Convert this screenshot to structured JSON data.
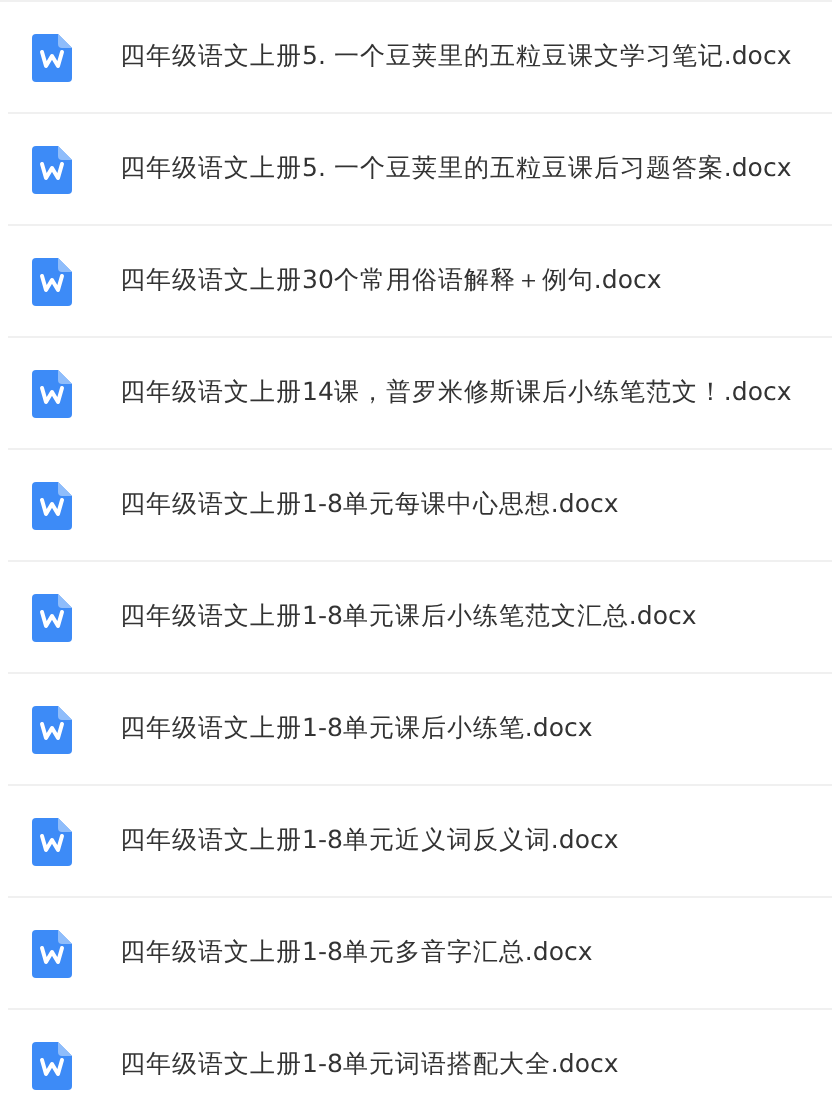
{
  "files": [
    {
      "name": "四年级语文上册5. 一个豆荚里的五粒豆课文学习笔记.docx"
    },
    {
      "name": "四年级语文上册5. 一个豆荚里的五粒豆课后习题答案.docx"
    },
    {
      "name": "四年级语文上册30个常用俗语解释＋例句.docx"
    },
    {
      "name": "四年级语文上册14课，普罗米修斯课后小练笔范文！.docx"
    },
    {
      "name": "四年级语文上册1-8单元每课中心思想.docx"
    },
    {
      "name": "四年级语文上册1-8单元课后小练笔范文汇总.docx"
    },
    {
      "name": "四年级语文上册1-8单元课后小练笔.docx"
    },
    {
      "name": "四年级语文上册1-8单元近义词反义词.docx"
    },
    {
      "name": "四年级语文上册1-8单元多音字汇总.docx"
    },
    {
      "name": "四年级语文上册1-8单元词语搭配大全.docx"
    }
  ]
}
